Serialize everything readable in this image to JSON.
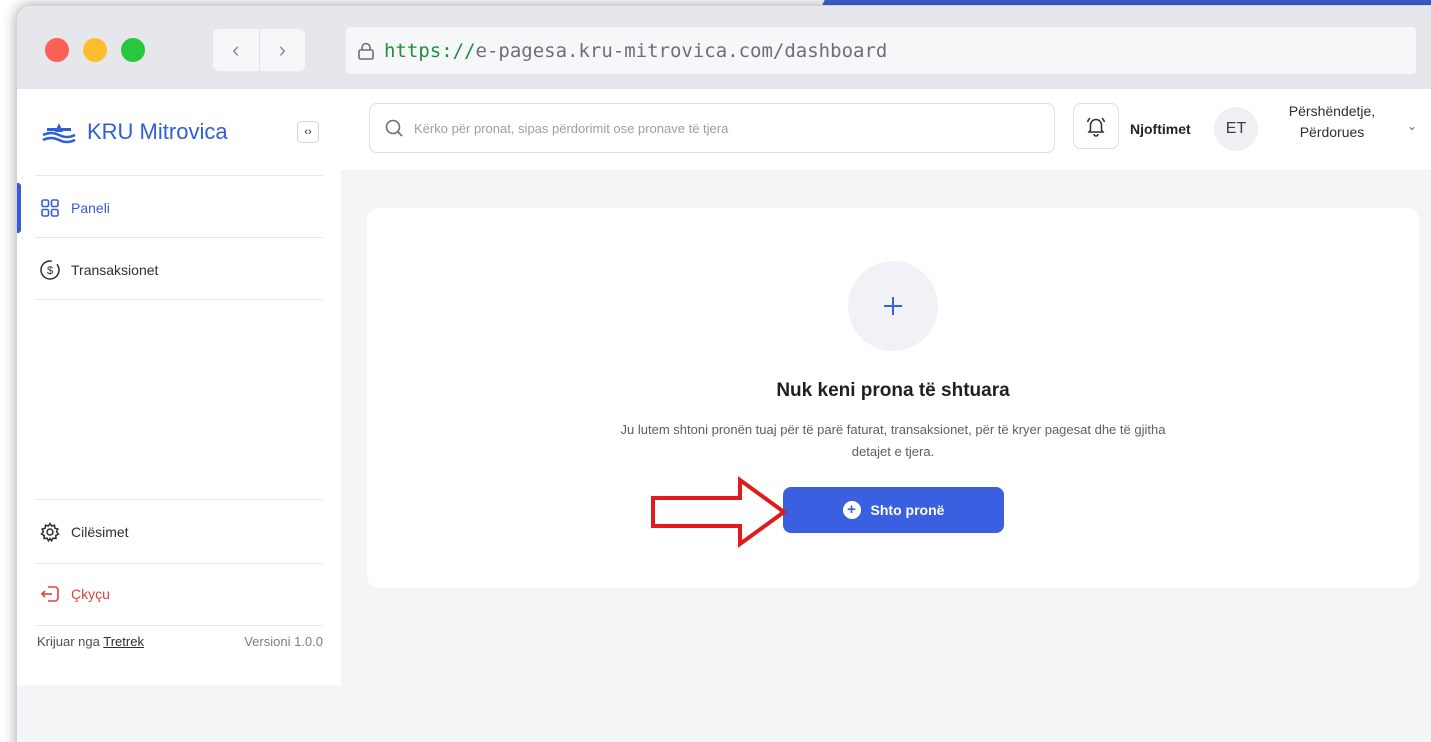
{
  "browser": {
    "url_protocol": "https://",
    "url_rest": "e-pagesa.kru-mitrovica.com/dashboard",
    "back_icon": "chevron-left-icon",
    "forward_icon": "chevron-right-icon"
  },
  "sidebar": {
    "logo_text": "KRU Mitrovica",
    "items": [
      {
        "label": "Paneli",
        "icon": "dashboard-grid-icon",
        "active": true
      },
      {
        "label": "Transaksionet",
        "icon": "dollar-circle-icon",
        "active": false
      }
    ],
    "settings_label": "Cilësimet",
    "logout_label": "Çkyçu",
    "footer": {
      "created_by": "Krijuar nga",
      "company": "Tretrek",
      "version": "Versioni 1.0.0"
    }
  },
  "topbar": {
    "search_placeholder": "Kërko për pronat, sipas përdorimit ose pronave të tjera",
    "notifications_label": "Njoftimet",
    "avatar_initials": "ET",
    "greeting_line1": "Përshëndetje,",
    "greeting_line2": "Përdorues"
  },
  "main": {
    "empty_title": "Nuk keni prona të shtuara",
    "empty_description": "Ju lutem shtoni pronën tuaj për të parë faturat, transaksionet, për të kryer pagesat dhe të gjitha detajet e tjera.",
    "add_button_label": "Shto pronë"
  },
  "colors": {
    "accent": "#3a5fe0",
    "logout": "#e0423a",
    "annotation_arrow": "#e01b1b"
  }
}
